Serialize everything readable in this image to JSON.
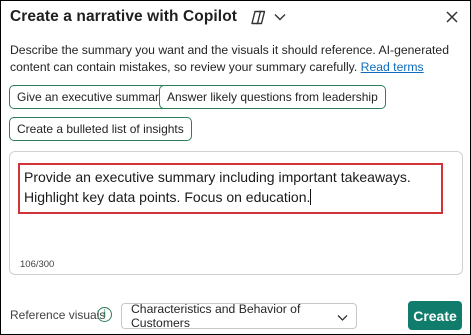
{
  "header": {
    "title": "Create a narrative with Copilot"
  },
  "description": {
    "text": "Describe the summary you want and the visuals it should reference. AI-generated content can contain mistakes, so review your summary carefully.",
    "link": "Read terms"
  },
  "suggestions": [
    {
      "label": "Give an executive summary"
    },
    {
      "label": "Answer likely questions from leadership"
    },
    {
      "label": "Create a bulleted list of insights"
    }
  ],
  "prompt": {
    "text": "Provide an executive summary including important takeaways. Highlight key data points. Focus on education.",
    "counter": "106/300"
  },
  "footer": {
    "reference_label": "Reference visuals",
    "selected_visual": "Characteristics and Behavior of Customers",
    "create_label": "Create"
  },
  "icons": {
    "copilot": "copilot-icon",
    "chevron": "chevron-down-icon",
    "close": "close-icon",
    "info": "info-icon"
  },
  "colors": {
    "accent": "#107c6c",
    "chip_border": "#2e7d5b",
    "highlight": "#d13438",
    "link": "#0f6cbd"
  }
}
